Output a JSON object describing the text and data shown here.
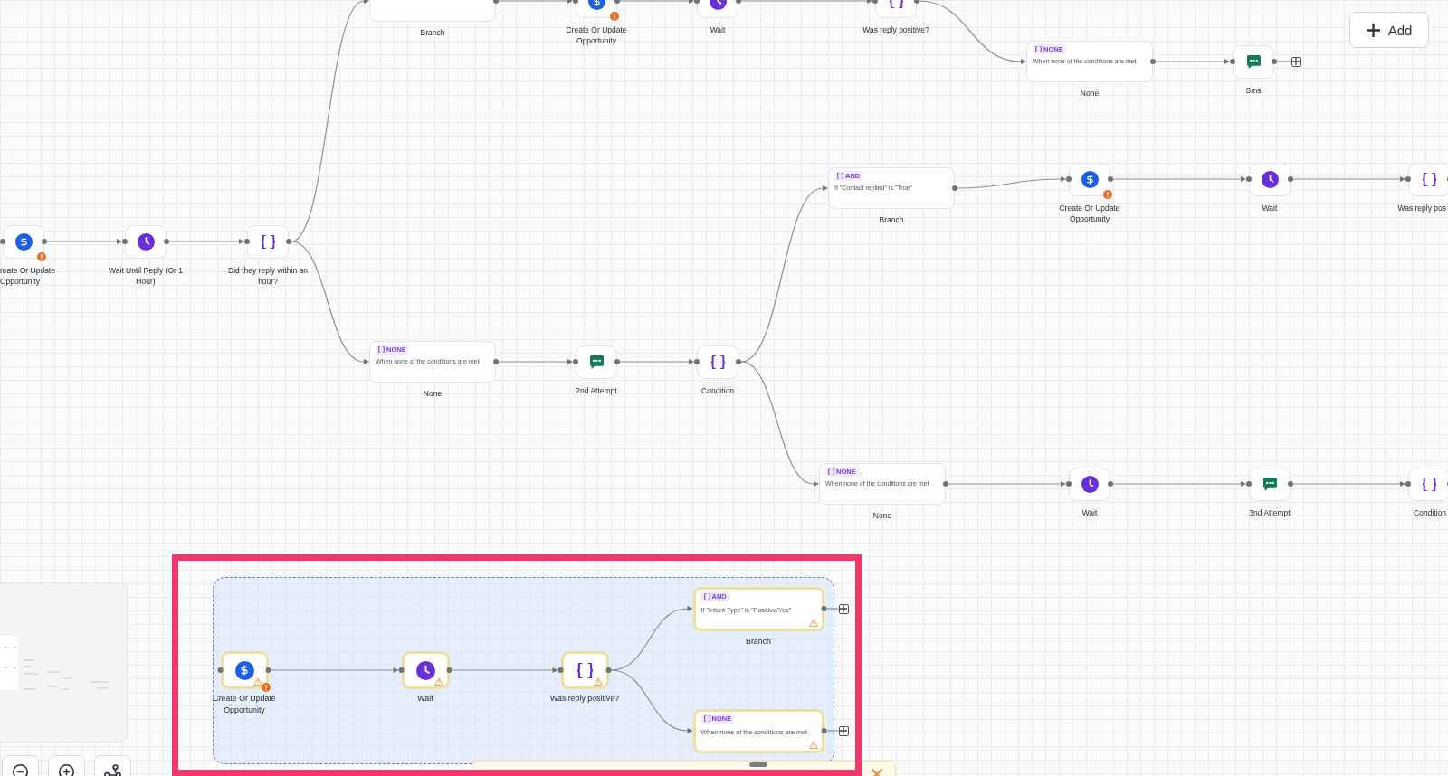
{
  "toolbar": {
    "add_button": {
      "label": "Add"
    }
  },
  "workflow": {
    "steps": [
      {
        "kind": "action",
        "label": "reate Or Update Opportunity",
        "error": true,
        "warning": false,
        "selected": false,
        "children": [
          {
            "kind": "wait",
            "label": "Wait Until Reply (Or 1 Hour)",
            "error": false,
            "warning": false,
            "selected": false,
            "children": [
              {
                "kind": "condition",
                "label": "Did they reply within an hour?",
                "error": false,
                "warning": false,
                "selected": false,
                "children": [
                  {
                    "kind": "branch",
                    "label": "Branch",
                    "error": false,
                    "warning": false,
                    "selected": false,
                    "children": [
                      {
                        "kind": "action",
                        "label": "Create Or Update Opportunity",
                        "error": true,
                        "warning": false,
                        "selected": false,
                        "children": [
                          {
                            "kind": "wait",
                            "label": "Wait",
                            "error": false,
                            "warning": false,
                            "selected": false,
                            "children": [
                              {
                                "kind": "condition",
                                "label": "Was reply positive?",
                                "error": false,
                                "warning": false,
                                "selected": false,
                                "children": [
                                  {
                                    "kind": "branch",
                                    "operator": "NONE",
                                    "condition": "When none of the conditions are met",
                                    "label": "None",
                                    "error": false,
                                    "warning": false,
                                    "selected": false,
                                    "children": [
                                      {
                                        "kind": "message",
                                        "label": "Sms",
                                        "error": false,
                                        "warning": false,
                                        "selected": false,
                                        "children": [
                                          {
                                            "kind": "add"
                                          }
                                        ]
                                      }
                                    ]
                                  }
                                ]
                              }
                            ]
                          }
                        ]
                      }
                    ]
                  },
                  {
                    "kind": "branch",
                    "operator": "NONE",
                    "condition": "When none of the conditions are met",
                    "label": "None",
                    "error": false,
                    "warning": false,
                    "selected": false,
                    "children": [
                      {
                        "kind": "message",
                        "label": "2nd Attempt",
                        "error": false,
                        "warning": false,
                        "selected": false,
                        "children": [
                          {
                            "kind": "condition",
                            "label": "Condition",
                            "error": false,
                            "warning": false,
                            "selected": false,
                            "children": [
                              {
                                "kind": "branch",
                                "operator": "AND",
                                "condition": "If \"Contact replied\" is \"True\"",
                                "label": "Branch",
                                "error": false,
                                "warning": false,
                                "selected": false,
                                "children": [
                                  {
                                    "kind": "action",
                                    "label": "Create Or Update Opportunity",
                                    "error": true,
                                    "warning": false,
                                    "selected": false,
                                    "children": [
                                      {
                                        "kind": "wait",
                                        "label": "Wait",
                                        "error": false,
                                        "warning": false,
                                        "selected": false,
                                        "children": [
                                          {
                                            "kind": "condition",
                                            "label": "Was reply pos",
                                            "error": false,
                                            "warning": false,
                                            "selected": false
                                          }
                                        ]
                                      }
                                    ]
                                  }
                                ]
                              },
                              {
                                "kind": "branch",
                                "operator": "NONE",
                                "condition": "When none of the conditions are met",
                                "label": "None",
                                "error": false,
                                "warning": false,
                                "selected": false,
                                "children": [
                                  {
                                    "kind": "wait",
                                    "label": "Wait",
                                    "error": false,
                                    "warning": false,
                                    "selected": false,
                                    "children": [
                                      {
                                        "kind": "message",
                                        "label": "3nd Attempt",
                                        "error": false,
                                        "warning": false,
                                        "selected": false,
                                        "children": [
                                          {
                                            "kind": "condition",
                                            "label": "Condition",
                                            "error": false,
                                            "warning": false,
                                            "selected": false
                                          }
                                        ]
                                      }
                                    ]
                                  }
                                ]
                              }
                            ]
                          }
                        ]
                      }
                    ]
                  }
                ]
              }
            ]
          }
        ]
      }
    ]
  },
  "selection": {
    "steps": [
      {
        "kind": "action",
        "label": "Create Or Update Opportunity",
        "error": true,
        "warning": true,
        "selected": true,
        "children": [
          {
            "kind": "wait",
            "label": "Wait",
            "error": false,
            "warning": true,
            "selected": true,
            "children": [
              {
                "kind": "condition",
                "label": "Was reply positive?",
                "error": false,
                "warning": true,
                "selected": true,
                "children": [
                  {
                    "kind": "branch",
                    "operator": "AND",
                    "condition": "If \"Intent Type\" is \"Positive/Yes\"",
                    "label": "Branch",
                    "error": false,
                    "warning": true,
                    "selected": true,
                    "children": [
                      {
                        "kind": "add"
                      }
                    ]
                  },
                  {
                    "kind": "branch",
                    "operator": "NONE",
                    "condition": "When none of the conditions are met",
                    "error": false,
                    "warning": true,
                    "selected": true,
                    "children": [
                      {
                        "kind": "add"
                      }
                    ]
                  }
                ]
              }
            ]
          }
        ]
      }
    ]
  }
}
